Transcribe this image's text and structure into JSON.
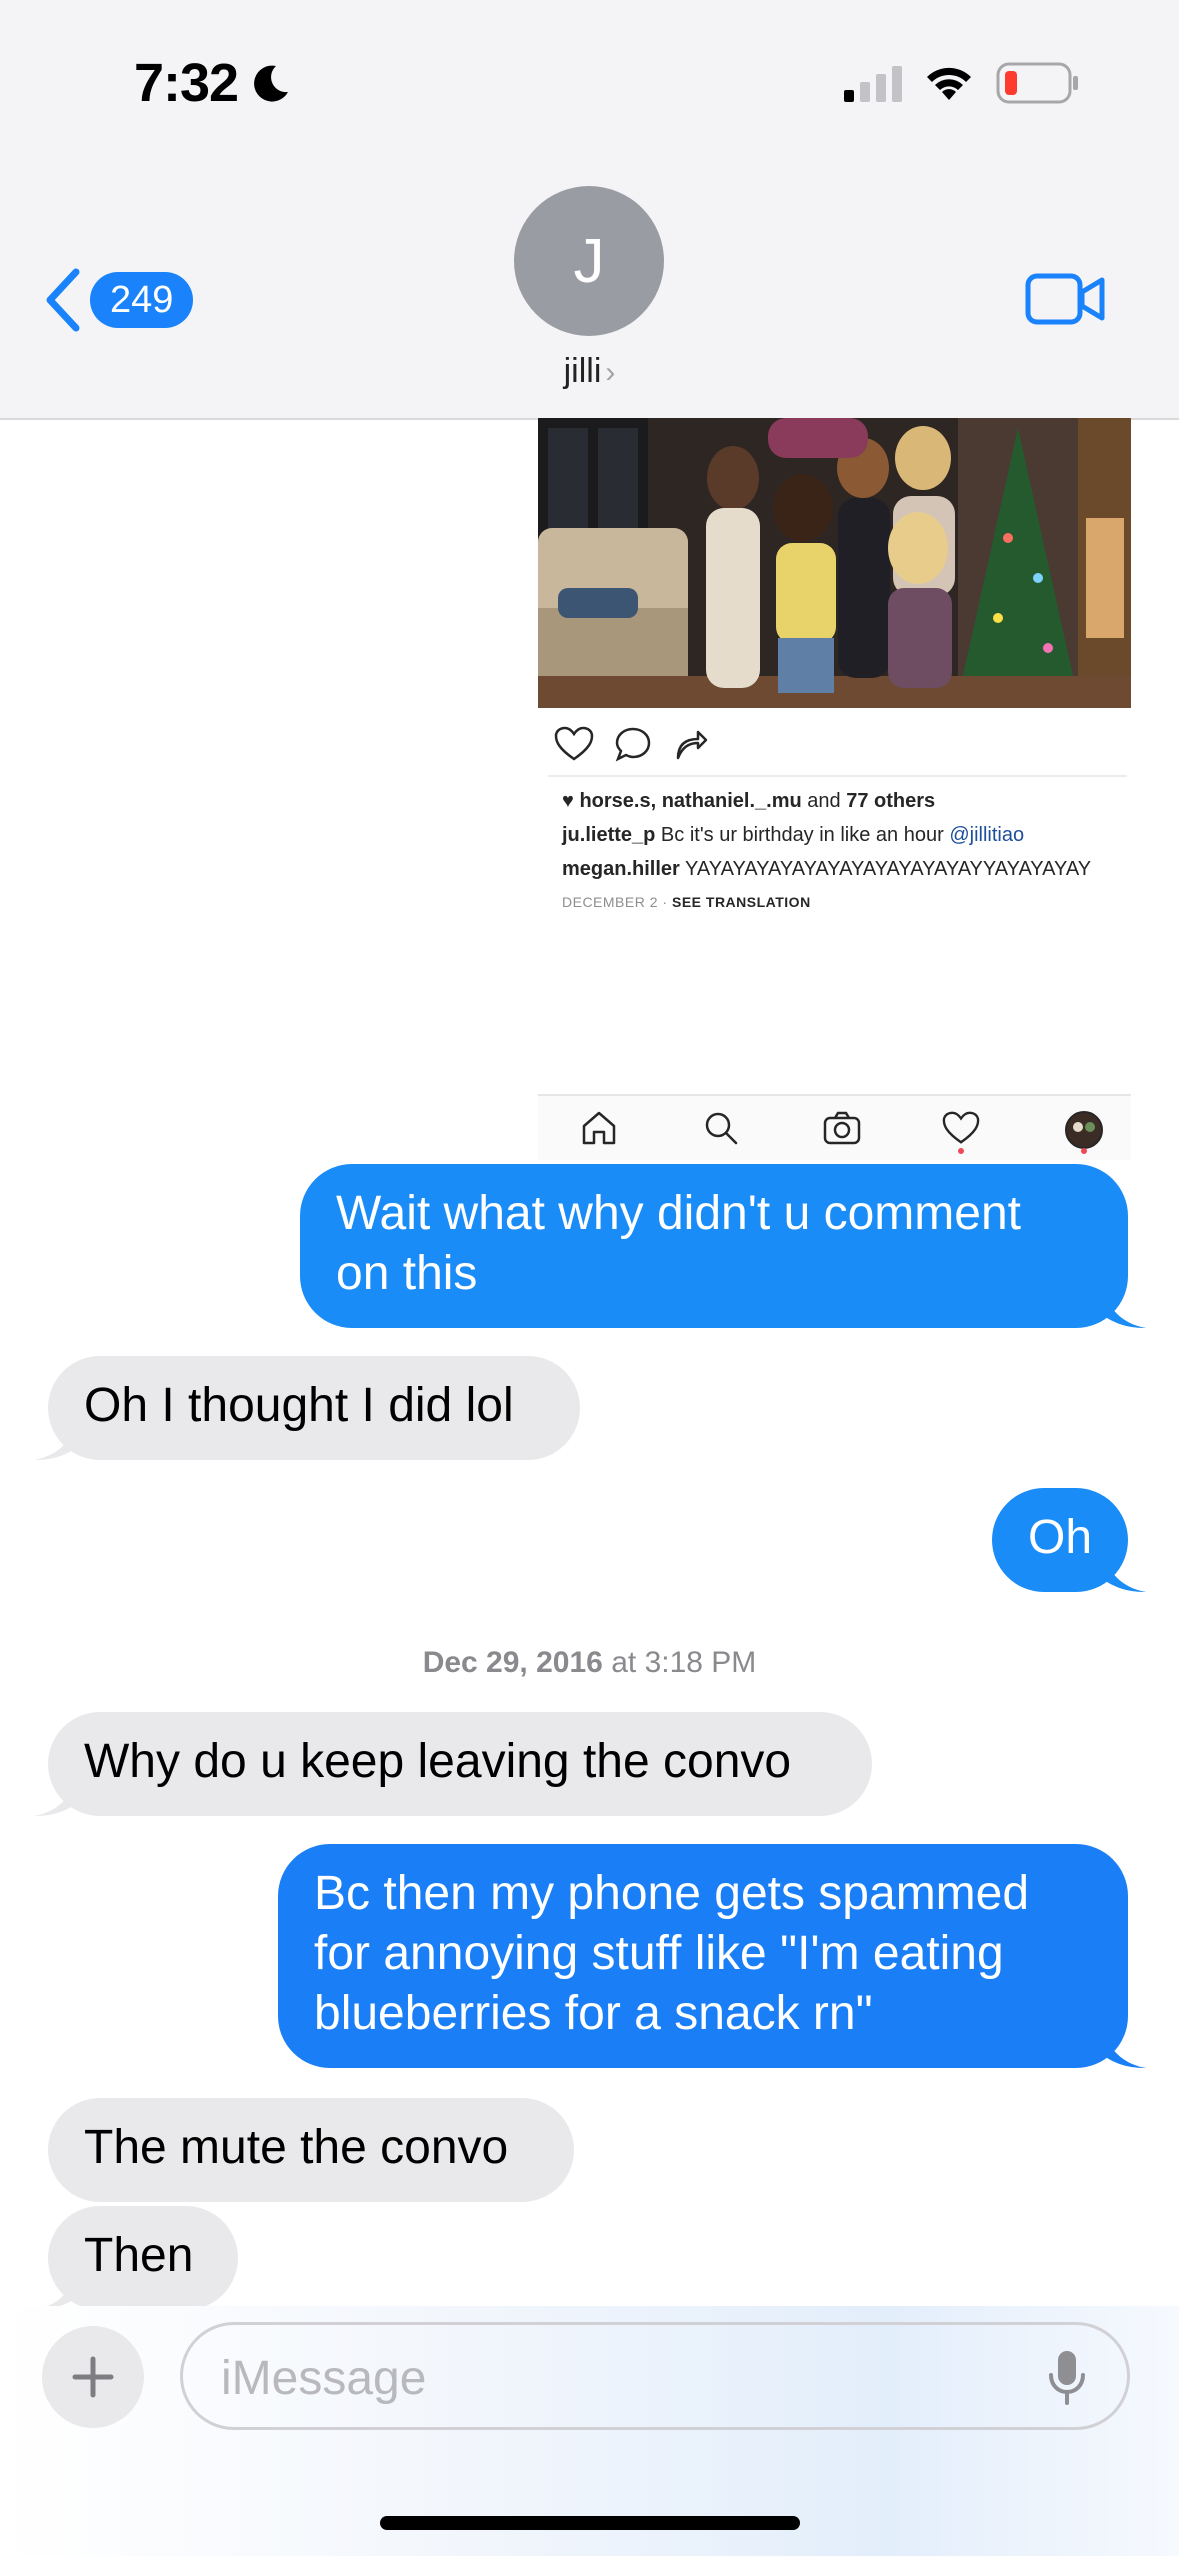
{
  "status_bar": {
    "time": "7:32",
    "icons": [
      "moon-icon",
      "cellular-signal-icon",
      "wifi-icon",
      "battery-low-icon"
    ]
  },
  "header": {
    "back_count": "249",
    "avatar_initial": "J",
    "contact_name": "jilli",
    "icons": [
      "chevron-left-icon",
      "chevron-right-icon",
      "video-camera-icon"
    ]
  },
  "instagram": {
    "likes_names": "horse.s, nathaniel._.mu",
    "likes_and": "and",
    "likes_others": "77 others",
    "comments": [
      {
        "user": "ju.liette_p",
        "text": "Bc it's ur birthday in like an hour",
        "mention": "@jillitiao"
      },
      {
        "user": "megan.hiller",
        "text": "YAYAYAYAYAYAYAYAYAYAYAYAYYAYAYAYAY",
        "mention": ""
      }
    ],
    "date": "DECEMBER 2",
    "see_translation": "SEE TRANSLATION",
    "icons": [
      "heart-icon",
      "comment-icon",
      "share-icon",
      "home-icon",
      "search-icon",
      "camera-icon",
      "activity-heart-icon",
      "profile-avatar"
    ]
  },
  "messages": [
    {
      "from": "me",
      "text_lines": [
        "Wait what why didn't u comment",
        "on this"
      ]
    },
    {
      "from": "them",
      "text_lines": [
        "Oh I thought I did lol"
      ]
    },
    {
      "from": "me",
      "text_lines": [
        "Oh"
      ]
    },
    {
      "from": "them",
      "text_lines": [
        "Why do u keep leaving the convo"
      ]
    },
    {
      "from": "me",
      "text_lines": [
        "Bc then my phone gets spammed",
        "for annoying stuff like \"I'm eating",
        "blueberries for a snack rn\""
      ]
    },
    {
      "from": "them",
      "text_lines": [
        "The mute the convo"
      ]
    },
    {
      "from": "them",
      "text_lines": [
        "Then"
      ]
    }
  ],
  "timestamp": {
    "date": "Dec 29, 2016",
    "at": "at",
    "time": "3:18 PM"
  },
  "compose": {
    "placeholder": "iMessage",
    "icons": [
      "plus-icon",
      "microphone-icon"
    ]
  },
  "colors": {
    "sent_bubble": "#1a8cf8",
    "received_bubble": "#e9e9eb",
    "accent": "#1a82fb"
  }
}
